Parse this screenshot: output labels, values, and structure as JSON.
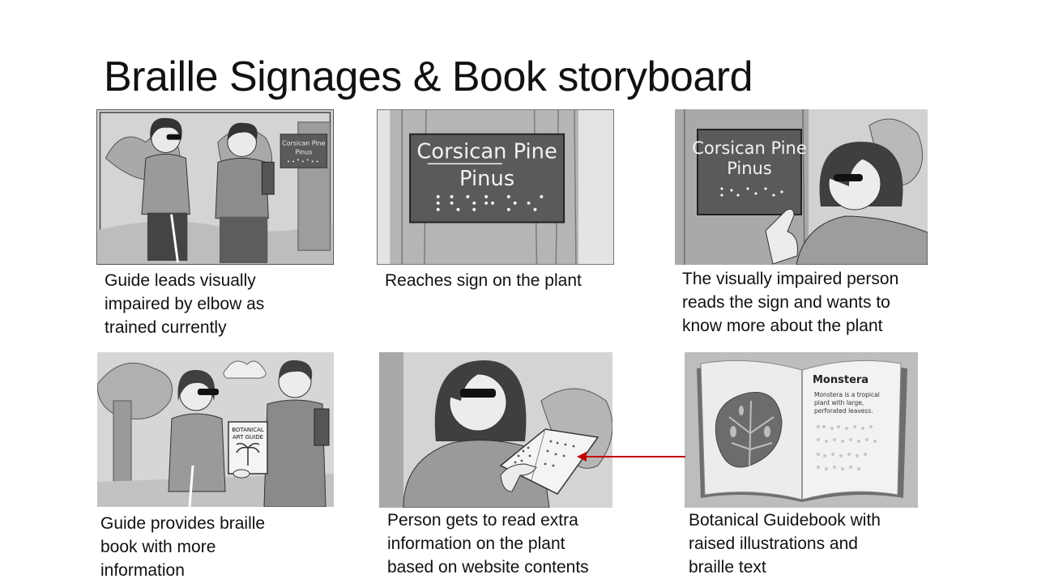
{
  "title": "Braille Signages & Book storyboard",
  "sign": {
    "line1": "Corsican Pine",
    "line2": "Pinus"
  },
  "book_cover": {
    "line1": "BOTANICAL",
    "line2": "ART GUIDE"
  },
  "guidebook": {
    "heading": "Monstera",
    "body_lines": [
      "Monstera is a tropical",
      "plant with large,",
      "perforated leavess."
    ]
  },
  "captions": [
    {
      "lines": [
        "Guide leads visually",
        "impaired by elbow as",
        "trained currently"
      ]
    },
    {
      "lines": [
        "Reaches sign on the plant"
      ]
    },
    {
      "lines": [
        "The visually impaired person",
        "reads the sign and wants to",
        "know more about the plant"
      ]
    },
    {
      "lines": [
        "Guide provides braille",
        "book with more",
        "information"
      ]
    },
    {
      "lines": [
        "Person gets to read extra",
        "information on the plant",
        "based on website contents"
      ]
    },
    {
      "lines": [
        "Botanical Guidebook with",
        "raised illustrations and",
        "braille text"
      ]
    }
  ],
  "colors": {
    "arrow": "#c00000",
    "sign_bg": "#5a5a5a",
    "panel_bg": "#d6d6d6"
  }
}
